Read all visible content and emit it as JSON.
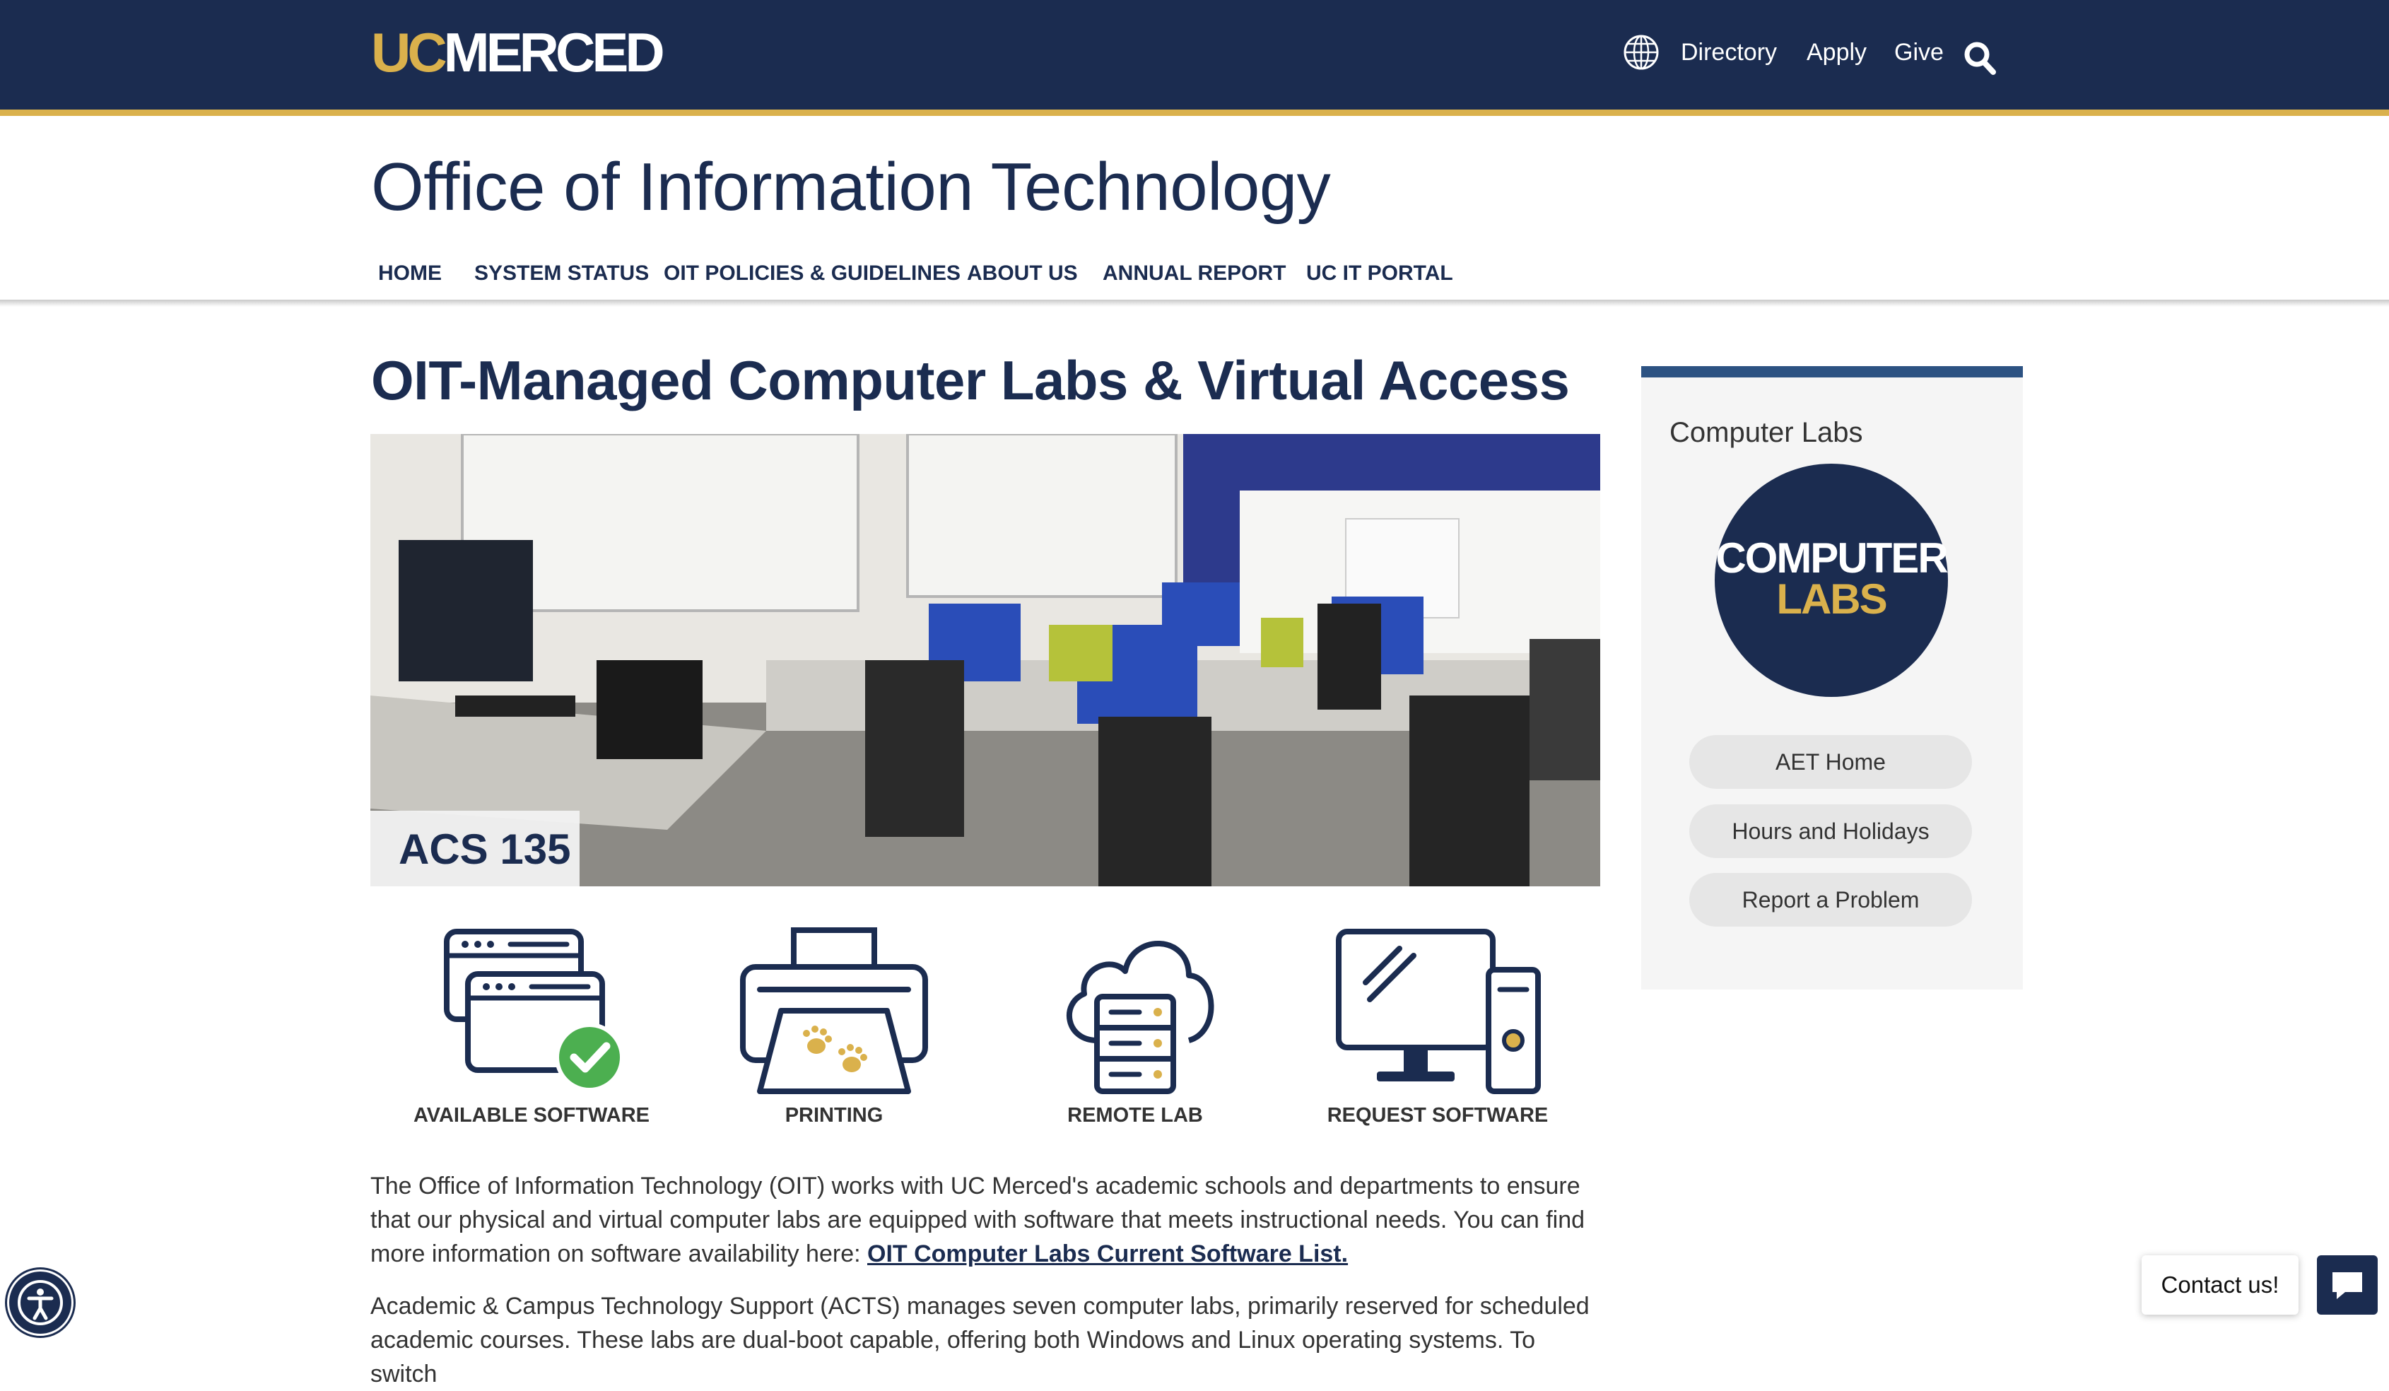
{
  "header": {
    "logo": {
      "uc": "UC",
      "merced": "MERCED"
    },
    "utility_links": [
      "Directory",
      "Apply",
      "Give"
    ],
    "icons": {
      "language": "globe-icon",
      "search": "search-icon"
    }
  },
  "site": {
    "title": "Office of Information Technology",
    "nav": [
      "HOME",
      "SYSTEM STATUS",
      "OIT POLICIES & GUIDELINES",
      "ABOUT US",
      "ANNUAL REPORT",
      "UC IT PORTAL"
    ]
  },
  "main": {
    "title": "OIT-Managed Computer Labs & Virtual Access",
    "hero_caption": "ACS 135",
    "features": [
      {
        "label": "AVAILABLE SOFTWARE",
        "icon": "software-windows-check-icon"
      },
      {
        "label": "PRINTING",
        "icon": "printer-paw-icon"
      },
      {
        "label": "REMOTE LAB",
        "icon": "cloud-server-icon"
      },
      {
        "label": "REQUEST SOFTWARE",
        "icon": "desktop-computer-icon"
      }
    ],
    "paragraph1": "The Office of Information Technology (OIT) works with UC Merced's academic schools and departments to ensure that our physical and virtual computer labs are equipped with software that meets instructional needs. You can find more information on software availability here: ",
    "paragraph1_link": "OIT Computer Labs Current Software List.",
    "paragraph2": "Academic & Campus Technology Support (ACTS) manages seven computer labs, primarily reserved for scheduled academic courses. These labs are dual-boot capable, offering both Windows and Linux operating systems. To switch"
  },
  "sidebar": {
    "title": "Computer Labs",
    "badge": {
      "line1": "COMPUTER",
      "line2": "LABS"
    },
    "buttons": [
      "AET Home",
      "Hours and Holidays",
      "Report a Problem"
    ]
  },
  "widgets": {
    "contact": "Contact us!",
    "icons": {
      "accessibility": "accessibility-icon",
      "chat": "chat-icon"
    }
  },
  "colors": {
    "navy": "#1b2c50",
    "gold": "#dab14c",
    "sidebar_accent": "#2c5282",
    "check_green": "#4caf50"
  }
}
